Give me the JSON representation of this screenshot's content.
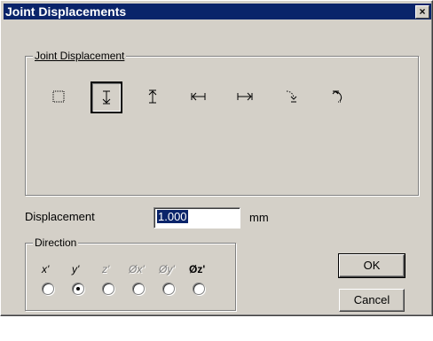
{
  "window": {
    "title": "Joint Displacements",
    "close_glyph": "×"
  },
  "joint_displacement": {
    "group_label": "Joint Displacement",
    "tools": [
      {
        "icon": "none-dotted-square-icon"
      },
      {
        "icon": "displacement-down-icon",
        "selected": true
      },
      {
        "icon": "displacement-up-icon"
      },
      {
        "icon": "displacement-left-icon"
      },
      {
        "icon": "displacement-right-icon"
      },
      {
        "icon": "rotation-cw-icon"
      },
      {
        "icon": "rotation-ccw-icon"
      }
    ]
  },
  "displacement": {
    "label": "Displacement",
    "value": "1.000",
    "unit": "mm"
  },
  "direction": {
    "group_label": "Direction",
    "options": [
      {
        "label": "x'",
        "enabled": true,
        "checked": false
      },
      {
        "label": "y'",
        "enabled": true,
        "checked": true
      },
      {
        "label": "z'",
        "enabled": false,
        "checked": false
      },
      {
        "label": "Øx'",
        "enabled": false,
        "checked": false
      },
      {
        "label": "Øy'",
        "enabled": false,
        "checked": false
      },
      {
        "label": "Øz'",
        "enabled": true,
        "checked": false
      }
    ]
  },
  "buttons": {
    "ok": "OK",
    "cancel": "Cancel"
  }
}
